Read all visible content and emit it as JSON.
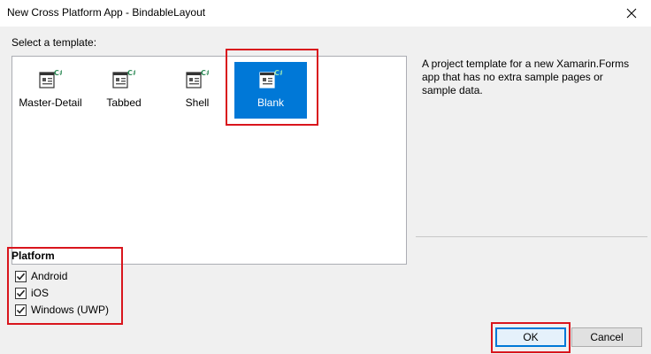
{
  "window": {
    "title": "New Cross Platform App - BindableLayout",
    "close_glyph": "✕"
  },
  "templates": {
    "label": "Select a template:",
    "items": [
      {
        "label": "Master-Detail",
        "icon": "csharp-template-icon"
      },
      {
        "label": "Tabbed",
        "icon": "csharp-template-icon"
      },
      {
        "label": "Shell",
        "icon": "csharp-template-icon"
      },
      {
        "label": "Blank",
        "icon": "csharp-template-icon",
        "selected": true
      }
    ],
    "description": "A project template for a new Xamarin.Forms app that has no extra sample pages or sample data."
  },
  "platform": {
    "heading": "Platform",
    "items": [
      {
        "label": "Android",
        "checked": true
      },
      {
        "label": "iOS",
        "checked": true
      },
      {
        "label": "Windows (UWP)",
        "checked": true
      }
    ]
  },
  "buttons": {
    "ok": "OK",
    "cancel": "Cancel"
  },
  "colors": {
    "selection": "#0078d7",
    "highlight": "#d9151d",
    "csharp_badge": "#2e8b57"
  }
}
